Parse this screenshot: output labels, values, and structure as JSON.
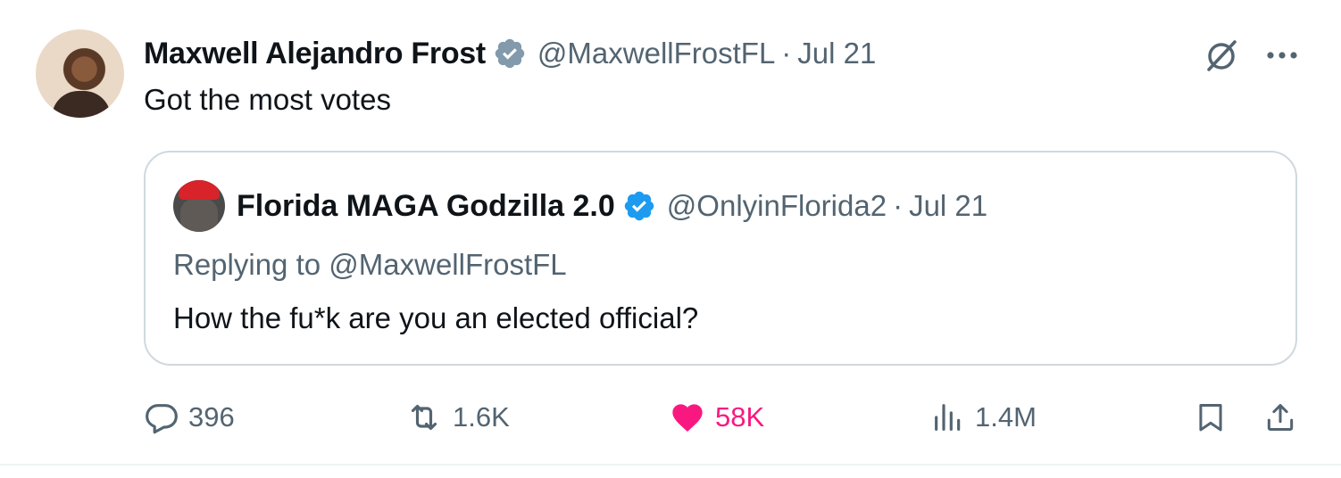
{
  "tweet": {
    "author_name": "Maxwell Alejandro Frost",
    "author_handle": "@MaxwellFrostFL",
    "separator": "·",
    "date": "Jul 21",
    "text": "Got the most votes"
  },
  "quoted": {
    "author_name": "Florida MAGA Godzilla 2.0",
    "author_handle": "@OnlyinFlorida2",
    "separator": "·",
    "date": "Jul 21",
    "replying_to": "Replying to @MaxwellFrostFL",
    "text": "How the fu*k are you an elected official?"
  },
  "actions": {
    "replies": "396",
    "reposts": "1.6K",
    "likes": "58K",
    "views": "1.4M"
  },
  "icons": {
    "verified": "verified-badge-icon",
    "grok": "grok-icon",
    "more": "more-icon",
    "reply": "reply-icon",
    "repost": "repost-icon",
    "like": "heart-icon",
    "views": "views-icon",
    "bookmark": "bookmark-icon",
    "share": "share-icon"
  },
  "colors": {
    "accent_blue": "#1d9bf0",
    "like_pink": "#f91880",
    "secondary_text": "#536471",
    "border": "#cfd9de"
  }
}
